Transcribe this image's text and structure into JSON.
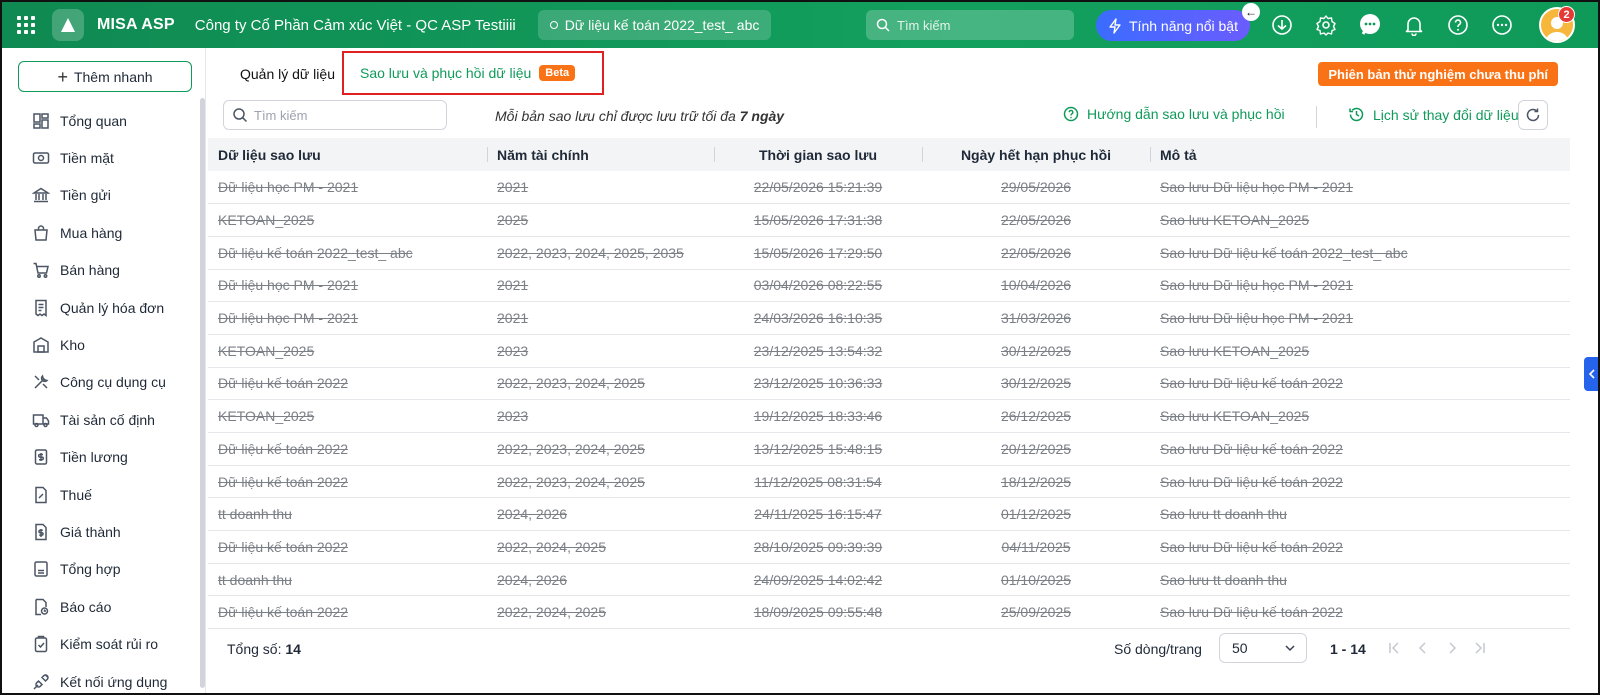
{
  "topbar": {
    "brand": "MISA ASP",
    "company": "Công ty Cổ Phần Cảm xúc Việt - QC ASP Testiiii",
    "database": "Dữ liệu kế toán 2022_test_ abc",
    "search_placeholder": "Tìm kiếm",
    "feature_button": "Tính năng nổi bật",
    "notification_count": "2"
  },
  "sidebar": {
    "quick_add": "Thêm nhanh",
    "items": [
      {
        "label": "Tổng quan",
        "icon": "dashboard-icon"
      },
      {
        "label": "Tiền mặt",
        "icon": "cash-icon"
      },
      {
        "label": "Tiền gửi",
        "icon": "bank-icon"
      },
      {
        "label": "Mua hàng",
        "icon": "shopping-bag-icon"
      },
      {
        "label": "Bán hàng",
        "icon": "cart-icon"
      },
      {
        "label": "Quản lý hóa đơn",
        "icon": "invoice-icon"
      },
      {
        "label": "Kho",
        "icon": "warehouse-icon"
      },
      {
        "label": "Công cụ dụng cụ",
        "icon": "tools-icon"
      },
      {
        "label": "Tài sản cố định",
        "icon": "truck-icon"
      },
      {
        "label": "Tiền lương",
        "icon": "payroll-icon"
      },
      {
        "label": "Thuế",
        "icon": "tax-icon"
      },
      {
        "label": "Giá thành",
        "icon": "cost-icon"
      },
      {
        "label": "Tổng hợp",
        "icon": "summary-icon"
      },
      {
        "label": "Báo cáo",
        "icon": "report-icon"
      },
      {
        "label": "Kiểm soát rủi ro",
        "icon": "risk-icon"
      },
      {
        "label": "Kết nối ứng dụng",
        "icon": "plug-icon"
      }
    ]
  },
  "tabs": {
    "manage": "Quản lý dữ liệu",
    "backup": "Sao lưu và phục hồi dữ liệu",
    "beta": "Beta",
    "trial_badge": "Phiên bản thử nghiệm chưa thu phí"
  },
  "toolbar": {
    "search_placeholder": "Tìm kiếm",
    "note_prefix": "Mỗi bản sao lưu chỉ được lưu trữ tối đa ",
    "note_bold": "7 ngày",
    "guide": "Hướng dẫn sao lưu và phục hồi",
    "history": "Lịch sử thay đổi dữ liệu"
  },
  "table": {
    "columns": [
      "Dữ liệu sao lưu",
      "Năm tài chính",
      "Thời gian sao lưu",
      "Ngày hết hạn phục hồi",
      "Mô tả"
    ],
    "rows": [
      [
        "Dữ liệu học PM - 2021",
        "2021",
        "22/05/2026 15:21:39",
        "29/05/2026",
        "Sao lưu Dữ liệu học PM - 2021"
      ],
      [
        "KETOAN_2025",
        "2025",
        "15/05/2026 17:31:38",
        "22/05/2026",
        "Sao lưu KETOAN_2025"
      ],
      [
        "Dữ liệu kế toán 2022_test_ abc",
        "2022, 2023, 2024, 2025, 2035",
        "15/05/2026 17:29:50",
        "22/05/2026",
        "Sao lưu Dữ liệu kế toán 2022_test_ abc"
      ],
      [
        "Dữ liệu học PM - 2021",
        "2021",
        "03/04/2026 08:22:55",
        "10/04/2026",
        "Sao lưu Dữ liệu học PM - 2021"
      ],
      [
        "Dữ liệu học PM - 2021",
        "2021",
        "24/03/2026 16:10:35",
        "31/03/2026",
        "Sao lưu Dữ liệu học PM - 2021"
      ],
      [
        "KETOAN_2025",
        "2023",
        "23/12/2025 13:54:32",
        "30/12/2025",
        "Sao lưu KETOAN_2025"
      ],
      [
        "Dữ liệu kế toán 2022",
        "2022, 2023, 2024, 2025",
        "23/12/2025 10:36:33",
        "30/12/2025",
        "Sao lưu Dữ liệu kế toán 2022"
      ],
      [
        "KETOAN_2025",
        "2023",
        "19/12/2025 18:33:46",
        "26/12/2025",
        "Sao lưu KETOAN_2025"
      ],
      [
        "Dữ liệu kế toán 2022",
        "2022, 2023, 2024, 2025",
        "13/12/2025 15:48:15",
        "20/12/2025",
        "Sao lưu Dữ liệu kế toán 2022"
      ],
      [
        "Dữ liệu kế toán 2022",
        "2022, 2023, 2024, 2025",
        "11/12/2025 08:31:54",
        "18/12/2025",
        "Sao lưu Dữ liệu kế toán 2022"
      ],
      [
        "tt doanh thu",
        "2024, 2026",
        "24/11/2025 16:15:47",
        "01/12/2025",
        "Sao lưu tt doanh thu"
      ],
      [
        "Dữ liệu kế toán 2022",
        "2022, 2024, 2025",
        "28/10/2025 09:39:39",
        "04/11/2025",
        "Sao lưu Dữ liệu kế toán 2022"
      ],
      [
        "tt doanh thu",
        "2024, 2026",
        "24/09/2025 14:02:42",
        "01/10/2025",
        "Sao lưu tt doanh thu"
      ],
      [
        "Dữ liệu kế toán 2022",
        "2022, 2024, 2025",
        "18/09/2025 09:55:48",
        "25/09/2025",
        "Sao lưu Dữ liệu kế toán 2022"
      ]
    ]
  },
  "footer": {
    "total_label": "Tổng số: ",
    "total_value": "14",
    "rows_per_page_label": "Số dòng/trang",
    "rows_per_page": "50",
    "range": "1 - 14"
  },
  "colors": {
    "brand_green": "#0f9a5a",
    "accent_orange": "#f97316",
    "highlight_red": "#e02020",
    "feature_blue": "#3b6cff"
  }
}
